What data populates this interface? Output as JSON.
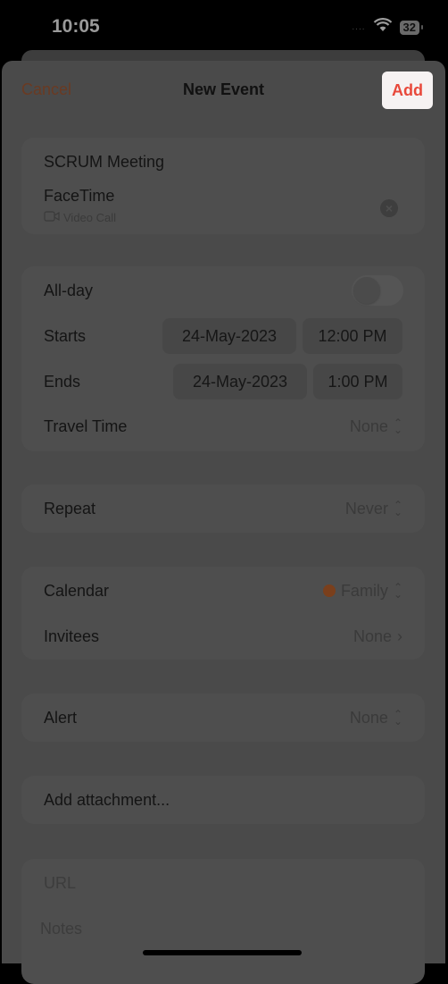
{
  "status_bar": {
    "time": "10:05",
    "battery": "32",
    "signal": "....",
    "wifi_icon": "wifi-icon"
  },
  "nav": {
    "cancel_label": "Cancel",
    "title": "New Event",
    "add_label": "Add"
  },
  "event": {
    "title": "SCRUM Meeting",
    "location": "FaceTime",
    "location_sub": "Video Call"
  },
  "time_group": {
    "allday_label": "All-day",
    "allday_on": false,
    "starts_label": "Starts",
    "starts_date": "24-May-2023",
    "starts_time": "12:00 PM",
    "ends_label": "Ends",
    "ends_date": "24-May-2023",
    "ends_time": "1:00 PM",
    "travel_label": "Travel Time",
    "travel_value": "None"
  },
  "repeat": {
    "label": "Repeat",
    "value": "Never"
  },
  "calendar": {
    "label": "Calendar",
    "value": "Family",
    "color": "#7a3f1c"
  },
  "invitees": {
    "label": "Invitees",
    "value": "None"
  },
  "alert": {
    "label": "Alert",
    "value": "None"
  },
  "attachment": {
    "label": "Add attachment..."
  },
  "extra": {
    "url_placeholder": "URL",
    "notes_placeholder": "Notes"
  },
  "colors": {
    "accent": "#e8483a",
    "cancel": "#6a3a22"
  }
}
